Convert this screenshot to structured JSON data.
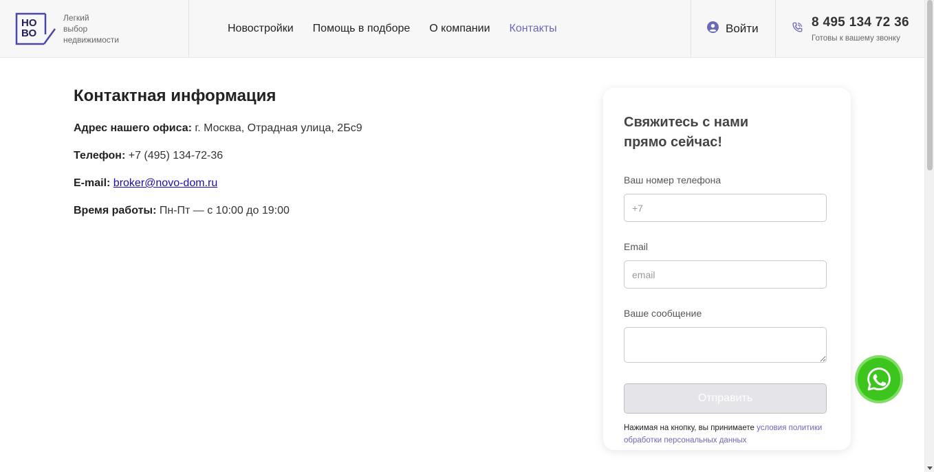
{
  "header": {
    "logo_letters": [
      "НО",
      "ВО"
    ],
    "tagline": [
      "Легкий",
      "выбор",
      "недвижимости"
    ],
    "nav": [
      {
        "label": "Новостройки",
        "active": false
      },
      {
        "label": "Помощь в подборе",
        "active": false
      },
      {
        "label": "О компании",
        "active": false
      },
      {
        "label": "Контакты",
        "active": true
      }
    ],
    "login_label": "Войти",
    "login_icon": "user-circle-icon",
    "phone_icon": "phone-icon",
    "phone": "8 495 134 72 36",
    "phone_sub": "Готовы к вашему звонку"
  },
  "contacts": {
    "title": "Контактная информация",
    "address_label": "Адрес нашего офиса:",
    "address_value": "г. Москва, Отрадная улица, 2Бс9",
    "phone_label": "Телефон:",
    "phone_value": "+7 (495) 134-72-36",
    "email_label": "E-mail:",
    "email_value": "broker@novo-dom.ru",
    "hours_label": "Время работы:",
    "hours_value": "Пн-Пт — с 10:00 до 19:00"
  },
  "form": {
    "title_line1": "Свяжитесь с нами",
    "title_line2": "прямо сейчас!",
    "phone_label": "Ваш номер телефона",
    "phone_placeholder": "+7",
    "email_label": "Email",
    "email_placeholder": "email",
    "message_label": "Ваше сообщение",
    "submit_label": "Отправить",
    "consent_text": "Нажимая на кнопку, вы принимаете ",
    "consent_link": "условия политики обработки персональных данных"
  },
  "whatsapp_icon": "whatsapp-icon",
  "colors": {
    "accent": "#6b68b4",
    "whatsapp": "#3cc51c"
  }
}
